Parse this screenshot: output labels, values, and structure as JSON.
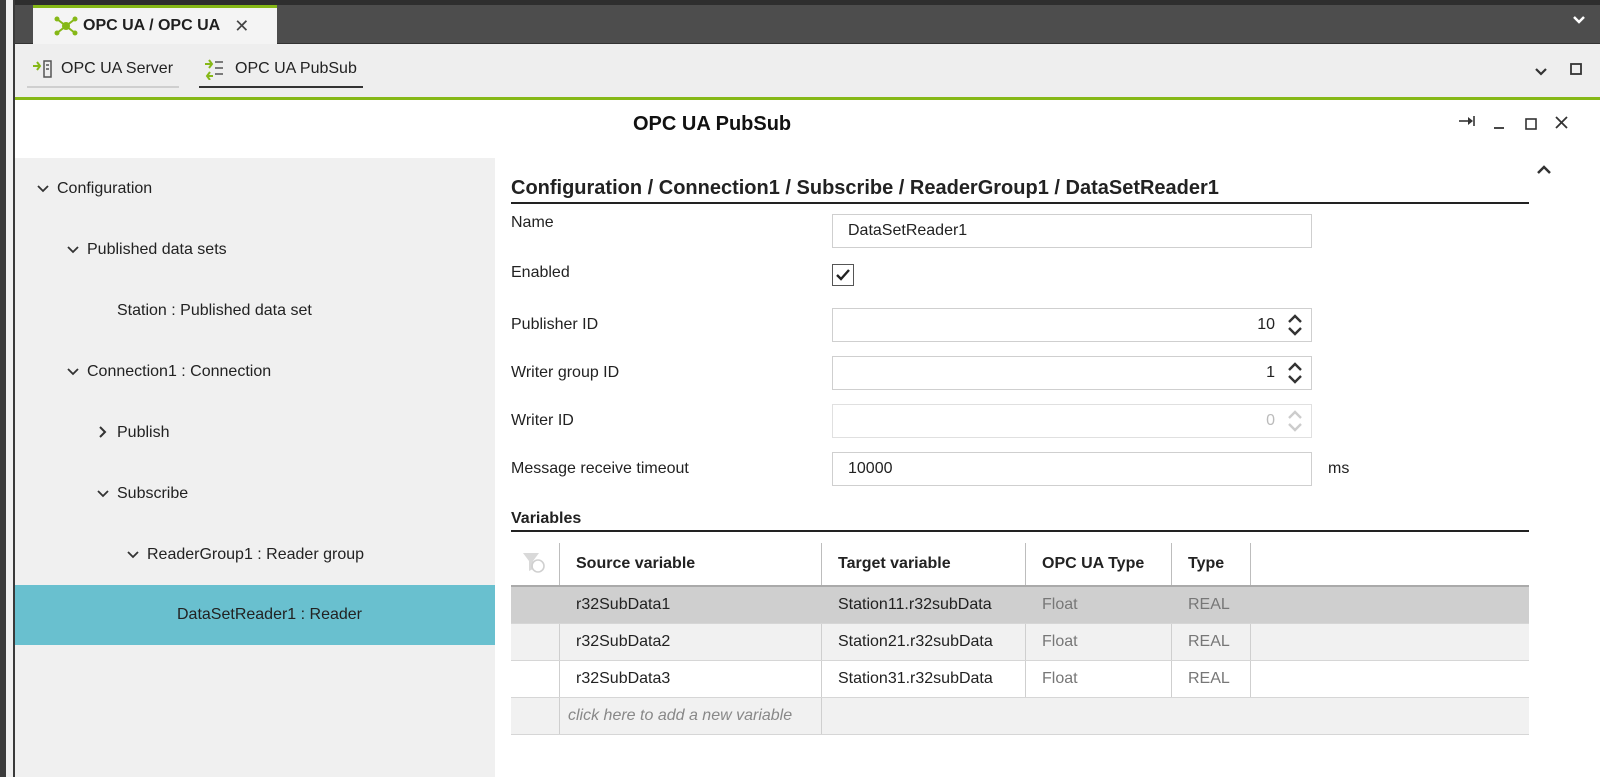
{
  "window": {
    "main_tab_label": "OPC UA / OPC UA",
    "close_glyph": "✕"
  },
  "subtabs": [
    {
      "label": "OPC UA Server",
      "icon": "server-icon"
    },
    {
      "label": "OPC UA PubSub",
      "icon": "pubsub-icon"
    }
  ],
  "panel": {
    "title": "OPC UA PubSub"
  },
  "tree": {
    "items": [
      {
        "label": "Configuration",
        "expanded": "open"
      },
      {
        "label": "Published data sets",
        "expanded": "open"
      },
      {
        "label": "Station : Published data set",
        "expanded": "leaf"
      },
      {
        "label": "Connection1 : Connection",
        "expanded": "open"
      },
      {
        "label": "Publish",
        "expanded": "closed"
      },
      {
        "label": "Subscribe",
        "expanded": "open"
      },
      {
        "label": "ReaderGroup1 : Reader group",
        "expanded": "open"
      },
      {
        "label": "DataSetReader1 : Reader",
        "expanded": "leaf",
        "selected": true
      }
    ]
  },
  "details": {
    "breadcrumb": "Configuration / Connection1 / Subscribe / ReaderGroup1 / DataSetReader1",
    "name_label": "Name",
    "name_value": "DataSetReader1",
    "enabled_label": "Enabled",
    "enabled_checked": true,
    "publisher_id_label": "Publisher ID",
    "publisher_id_value": "10",
    "writer_group_id_label": "Writer group ID",
    "writer_group_id_value": "1",
    "writer_id_label": "Writer ID",
    "writer_id_value": "0",
    "timeout_label": "Message receive timeout",
    "timeout_value": "10000",
    "timeout_unit": "ms",
    "variables_title": "Variables"
  },
  "variables_table": {
    "headers": [
      "Source variable",
      "Target variable",
      "OPC UA Type",
      "Type"
    ],
    "rows": [
      [
        "r32SubData1",
        "Station11.r32subData",
        "Float",
        "REAL"
      ],
      [
        "r32SubData2",
        "Station21.r32subData",
        "Float",
        "REAL"
      ],
      [
        "r32SubData3",
        "Station31.r32subData",
        "Float",
        "REAL"
      ]
    ],
    "add_placeholder": "click here to add a new variable"
  },
  "colors": {
    "accent_green": "#86b817",
    "selection_teal": "#69c0cf"
  }
}
